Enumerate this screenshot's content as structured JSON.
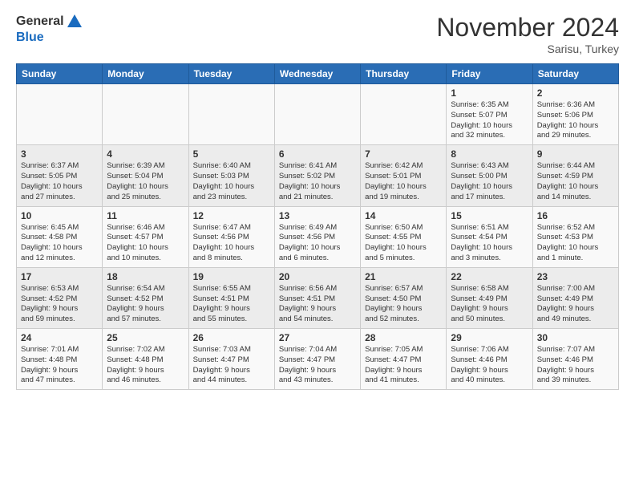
{
  "header": {
    "logo_general": "General",
    "logo_blue": "Blue",
    "month_title": "November 2024",
    "location": "Sarisu, Turkey"
  },
  "weekdays": [
    "Sunday",
    "Monday",
    "Tuesday",
    "Wednesday",
    "Thursday",
    "Friday",
    "Saturday"
  ],
  "weeks": [
    [
      {
        "day": "",
        "info": ""
      },
      {
        "day": "",
        "info": ""
      },
      {
        "day": "",
        "info": ""
      },
      {
        "day": "",
        "info": ""
      },
      {
        "day": "",
        "info": ""
      },
      {
        "day": "1",
        "info": "Sunrise: 6:35 AM\nSunset: 5:07 PM\nDaylight: 10 hours\nand 32 minutes."
      },
      {
        "day": "2",
        "info": "Sunrise: 6:36 AM\nSunset: 5:06 PM\nDaylight: 10 hours\nand 29 minutes."
      }
    ],
    [
      {
        "day": "3",
        "info": "Sunrise: 6:37 AM\nSunset: 5:05 PM\nDaylight: 10 hours\nand 27 minutes."
      },
      {
        "day": "4",
        "info": "Sunrise: 6:39 AM\nSunset: 5:04 PM\nDaylight: 10 hours\nand 25 minutes."
      },
      {
        "day": "5",
        "info": "Sunrise: 6:40 AM\nSunset: 5:03 PM\nDaylight: 10 hours\nand 23 minutes."
      },
      {
        "day": "6",
        "info": "Sunrise: 6:41 AM\nSunset: 5:02 PM\nDaylight: 10 hours\nand 21 minutes."
      },
      {
        "day": "7",
        "info": "Sunrise: 6:42 AM\nSunset: 5:01 PM\nDaylight: 10 hours\nand 19 minutes."
      },
      {
        "day": "8",
        "info": "Sunrise: 6:43 AM\nSunset: 5:00 PM\nDaylight: 10 hours\nand 17 minutes."
      },
      {
        "day": "9",
        "info": "Sunrise: 6:44 AM\nSunset: 4:59 PM\nDaylight: 10 hours\nand 14 minutes."
      }
    ],
    [
      {
        "day": "10",
        "info": "Sunrise: 6:45 AM\nSunset: 4:58 PM\nDaylight: 10 hours\nand 12 minutes."
      },
      {
        "day": "11",
        "info": "Sunrise: 6:46 AM\nSunset: 4:57 PM\nDaylight: 10 hours\nand 10 minutes."
      },
      {
        "day": "12",
        "info": "Sunrise: 6:47 AM\nSunset: 4:56 PM\nDaylight: 10 hours\nand 8 minutes."
      },
      {
        "day": "13",
        "info": "Sunrise: 6:49 AM\nSunset: 4:56 PM\nDaylight: 10 hours\nand 6 minutes."
      },
      {
        "day": "14",
        "info": "Sunrise: 6:50 AM\nSunset: 4:55 PM\nDaylight: 10 hours\nand 5 minutes."
      },
      {
        "day": "15",
        "info": "Sunrise: 6:51 AM\nSunset: 4:54 PM\nDaylight: 10 hours\nand 3 minutes."
      },
      {
        "day": "16",
        "info": "Sunrise: 6:52 AM\nSunset: 4:53 PM\nDaylight: 10 hours\nand 1 minute."
      }
    ],
    [
      {
        "day": "17",
        "info": "Sunrise: 6:53 AM\nSunset: 4:52 PM\nDaylight: 9 hours\nand 59 minutes."
      },
      {
        "day": "18",
        "info": "Sunrise: 6:54 AM\nSunset: 4:52 PM\nDaylight: 9 hours\nand 57 minutes."
      },
      {
        "day": "19",
        "info": "Sunrise: 6:55 AM\nSunset: 4:51 PM\nDaylight: 9 hours\nand 55 minutes."
      },
      {
        "day": "20",
        "info": "Sunrise: 6:56 AM\nSunset: 4:51 PM\nDaylight: 9 hours\nand 54 minutes."
      },
      {
        "day": "21",
        "info": "Sunrise: 6:57 AM\nSunset: 4:50 PM\nDaylight: 9 hours\nand 52 minutes."
      },
      {
        "day": "22",
        "info": "Sunrise: 6:58 AM\nSunset: 4:49 PM\nDaylight: 9 hours\nand 50 minutes."
      },
      {
        "day": "23",
        "info": "Sunrise: 7:00 AM\nSunset: 4:49 PM\nDaylight: 9 hours\nand 49 minutes."
      }
    ],
    [
      {
        "day": "24",
        "info": "Sunrise: 7:01 AM\nSunset: 4:48 PM\nDaylight: 9 hours\nand 47 minutes."
      },
      {
        "day": "25",
        "info": "Sunrise: 7:02 AM\nSunset: 4:48 PM\nDaylight: 9 hours\nand 46 minutes."
      },
      {
        "day": "26",
        "info": "Sunrise: 7:03 AM\nSunset: 4:47 PM\nDaylight: 9 hours\nand 44 minutes."
      },
      {
        "day": "27",
        "info": "Sunrise: 7:04 AM\nSunset: 4:47 PM\nDaylight: 9 hours\nand 43 minutes."
      },
      {
        "day": "28",
        "info": "Sunrise: 7:05 AM\nSunset: 4:47 PM\nDaylight: 9 hours\nand 41 minutes."
      },
      {
        "day": "29",
        "info": "Sunrise: 7:06 AM\nSunset: 4:46 PM\nDaylight: 9 hours\nand 40 minutes."
      },
      {
        "day": "30",
        "info": "Sunrise: 7:07 AM\nSunset: 4:46 PM\nDaylight: 9 hours\nand 39 minutes."
      }
    ]
  ]
}
